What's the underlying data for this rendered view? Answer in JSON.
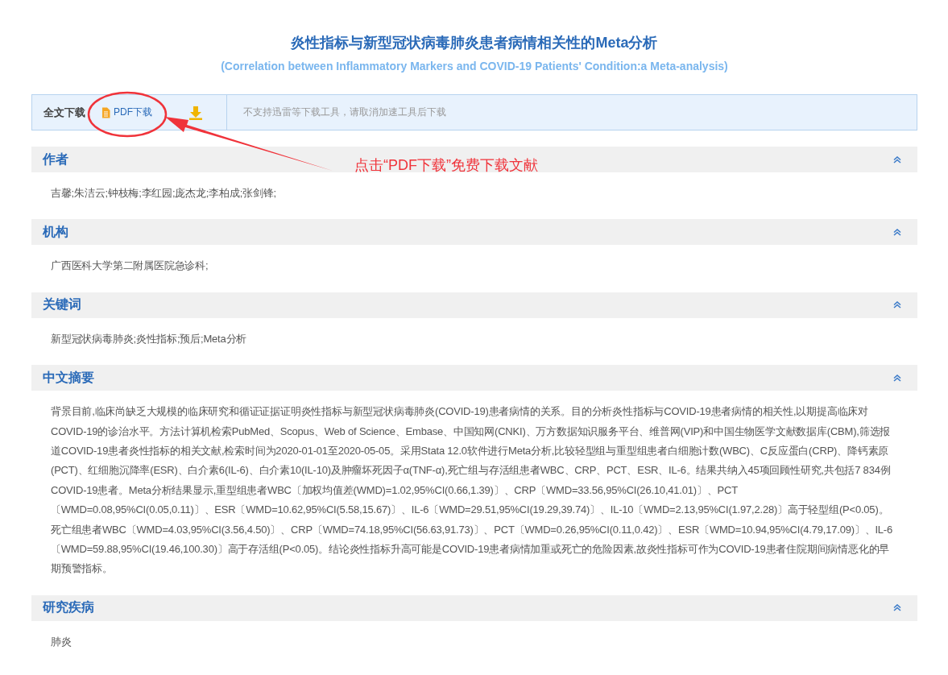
{
  "title": "炎性指标与新型冠状病毒肺炎患者病情相关性的Meta分析",
  "subtitle": "(Correlation between Inflammatory Markers and COVID-19 Patients' Condition:a Meta-analysis)",
  "download_bar": {
    "label": "全文下载",
    "pdf_link": "PDF下载",
    "notice": "不支持迅雷等下载工具，请取消加速工具后下载"
  },
  "annotation": {
    "text": "点击“PDF下载”免费下载文献"
  },
  "sections": [
    {
      "heading": "作者",
      "expanded": true,
      "content": "吉馨;朱洁云;钟枝梅;李红园;庞杰龙;李柏成;张剑锋;"
    },
    {
      "heading": "机构",
      "expanded": true,
      "content": "广西医科大学第二附属医院急诊科;"
    },
    {
      "heading": "关键词",
      "expanded": true,
      "content": "新型冠状病毒肺炎;炎性指标;预后;Meta分析"
    },
    {
      "heading": "中文摘要",
      "expanded": true,
      "content": "背景目前,临床尚缺乏大规模的临床研究和循证证据证明炎性指标与新型冠状病毒肺炎(COVID-19)患者病情的关系。目的分析炎性指标与COVID-19患者病情的相关性,以期提高临床对COVID-19的诊治水平。方法计算机检索PubMed、Scopus、Web of Science、Embase、中国知网(CNKI)、万方数据知识服务平台、维普网(VIP)和中国生物医学文献数据库(CBM),筛选报道COVID-19患者炎性指标的相关文献,检索时间为2020-01-01至2020-05-05。采用Stata 12.0软件进行Meta分析,比较轻型组与重型组患者白细胞计数(WBC)、C反应蛋白(CRP)、降钙素原(PCT)、红细胞沉降率(ESR)、白介素6(IL-6)、白介素10(IL-10)及肿瘤坏死因子α(TNF-α),死亡组与存活组患者WBC、CRP、PCT、ESR、IL-6。结果共纳入45项回顾性研究,共包括7 834例COVID-19患者。Meta分析结果显示,重型组患者WBC〔加权均值差(WMD)=1.02,95%CI(0.66,1.39)〕、CRP〔WMD=33.56,95%CI(26.10,41.01)〕、PCT〔WMD=0.08,95%CI(0.05,0.11)〕、ESR〔WMD=10.62,95%CI(5.58,15.67)〕、IL-6〔WMD=29.51,95%CI(19.29,39.74)〕、IL-10〔WMD=2.13,95%CI(1.97,2.28)〕高于轻型组(P<0.05)。死亡组患者WBC〔WMD=4.03,95%CI(3.56,4.50)〕、CRP〔WMD=74.18,95%CI(56.63,91.73)〕、PCT〔WMD=0.26,95%CI(0.11,0.42)〕、ESR〔WMD=10.94,95%CI(4.79,17.09)〕、IL-6〔WMD=59.88,95%CI(19.46,100.30)〕高于存活组(P<0.05)。结论炎性指标升高可能是COVID-19患者病情加重或死亡的危险因素,故炎性指标可作为COVID-19患者住院期间病情恶化的早期预警指标。"
    },
    {
      "heading": "研究疾病",
      "expanded": true,
      "content": "肺炎"
    }
  ]
}
